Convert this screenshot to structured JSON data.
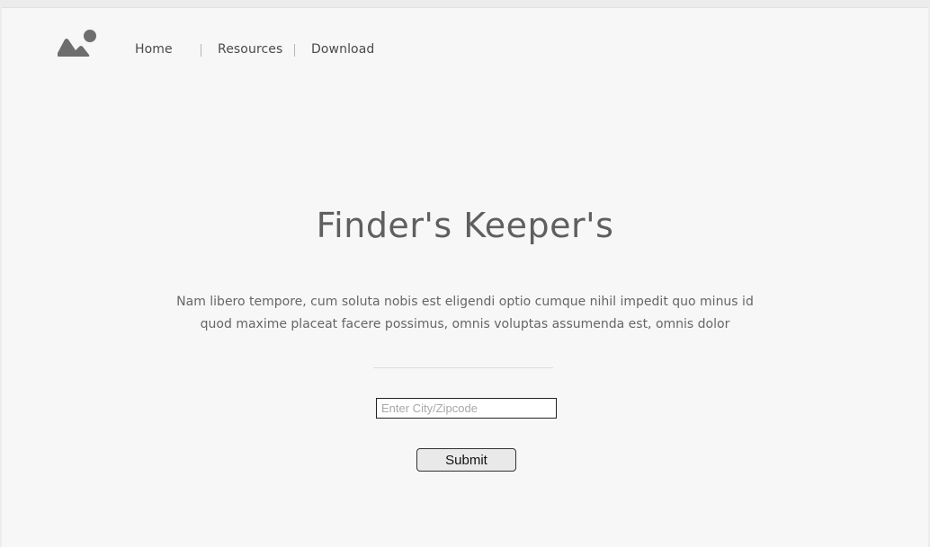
{
  "nav": {
    "logo_icon": "image-placeholder-icon",
    "items": [
      {
        "label": "Home"
      },
      {
        "label": "Resources"
      },
      {
        "label": "Download"
      }
    ]
  },
  "hero": {
    "title": "Finder's Keeper's",
    "description_line1": "Nam libero tempore, cum soluta nobis est eligendi optio cumque nihil impedit quo minus id",
    "description_line2": "quod maxime placeat facere possimus, omnis voluptas assumenda est, omnis dolor"
  },
  "search": {
    "value": "",
    "placeholder": "Enter City/Zipcode",
    "submit_label": "Submit"
  },
  "colors": {
    "background": "#f7f7f7",
    "text": "#5f5f5f",
    "logo": "#6e6e6e"
  }
}
